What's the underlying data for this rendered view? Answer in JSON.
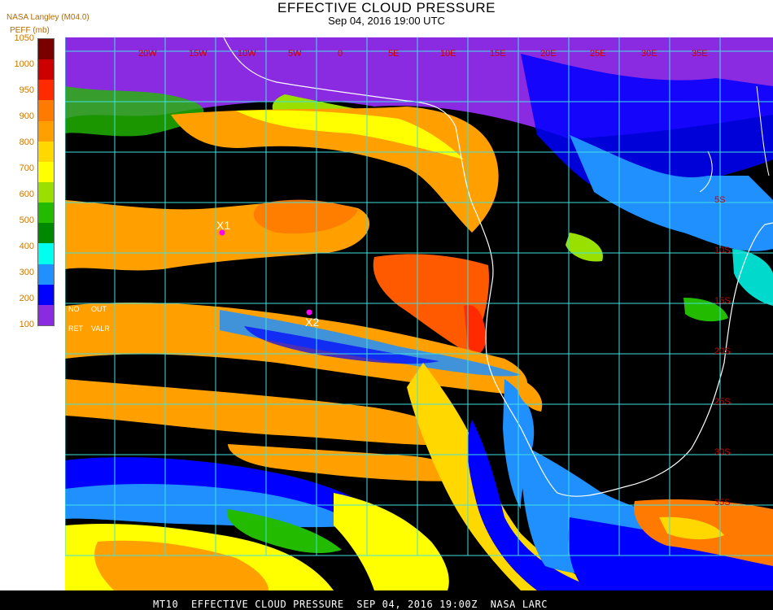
{
  "title": "EFFECTIVE CLOUD PRESSURE",
  "subtitle": "Sep 04, 2016 19:00 UTC",
  "provider": "NASA Langley (M04.0)",
  "units": "PEFF (mb)",
  "legend": {
    "ticks": [
      "1050",
      "1000",
      "950",
      "900",
      "800",
      "700",
      "600",
      "500",
      "400",
      "300",
      "200",
      "100"
    ],
    "colors": [
      "#7a0000",
      "#cc0000",
      "#ff2a00",
      "#ff7a00",
      "#ffa000",
      "#ffd800",
      "#ffff00",
      "#99e000",
      "#22bb00",
      "#008800",
      "#00ffee",
      "#2090ff",
      "#0000ff",
      "#8a2be2"
    ]
  },
  "map": {
    "lon_labels": [
      "20W",
      "15W",
      "10W",
      "5W",
      "0",
      "5E",
      "10E",
      "15E",
      "20E",
      "25E",
      "30E",
      "35E"
    ],
    "lat_labels": [
      "5S",
      "10S",
      "15S",
      "20S",
      "25S",
      "30S",
      "35S"
    ],
    "panel_labels": [
      "NO",
      "OUT",
      "RET",
      "VALR"
    ],
    "markers": [
      "X1",
      "X2"
    ],
    "grid_color": "#40e0e0",
    "label_color": "#cc0000"
  },
  "footer": "MT10  EFFECTIVE CLOUD PRESSURE  SEP 04, 2016 19:00Z  NASA LARC"
}
